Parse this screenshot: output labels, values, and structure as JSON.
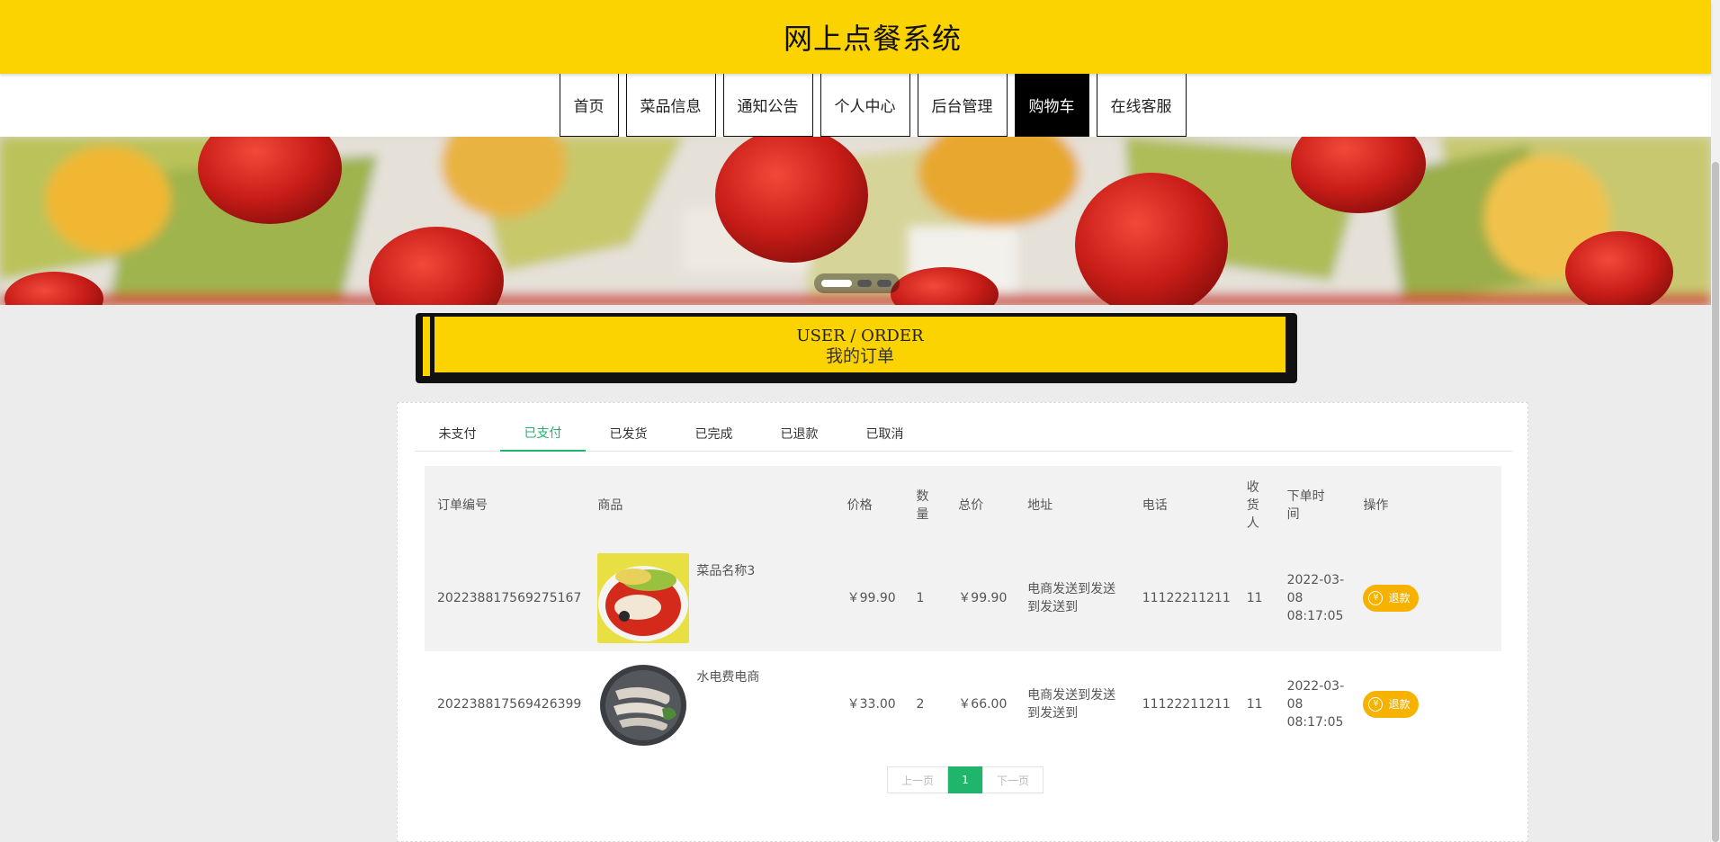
{
  "header": {
    "title": "网上点餐系统"
  },
  "nav": {
    "items": [
      {
        "label": "首页",
        "active": false
      },
      {
        "label": "菜品信息",
        "active": false
      },
      {
        "label": "通知公告",
        "active": false
      },
      {
        "label": "个人中心",
        "active": false
      },
      {
        "label": "后台管理",
        "active": false
      },
      {
        "label": "购物车",
        "active": true
      },
      {
        "label": "在线客服",
        "active": false
      }
    ]
  },
  "carousel": {
    "slides": 3,
    "active_index": 0
  },
  "section": {
    "title_en": "USER / ORDER",
    "title_cn": "我的订单"
  },
  "tabs": {
    "items": [
      "未支付",
      "已支付",
      "已发货",
      "已完成",
      "已退款",
      "已取消"
    ],
    "active_index": 1
  },
  "table": {
    "headers": {
      "order_no": "订单编号",
      "goods": "商品",
      "price": "价格",
      "qty": "数量",
      "total": "总价",
      "address": "地址",
      "phone": "电话",
      "receiver": "收货人",
      "time": "下单时间",
      "action": "操作"
    },
    "rows": [
      {
        "order_no": "202238817569275167",
        "goods_name": "菜品名称3",
        "goods_image": "fish-dish-image",
        "price": "￥99.90",
        "qty": "1",
        "total": "￥99.90",
        "address": "电商发送到发送到发送到",
        "phone": "11122211211",
        "receiver": "11",
        "time": "2022-03-08 08:17:05",
        "action": "退款"
      },
      {
        "order_no": "202238817569426399",
        "goods_name": "水电费电商",
        "goods_image": "shrimp-dish-image",
        "price": "￥33.00",
        "qty": "2",
        "total": "￥66.00",
        "address": "电商发送到发送到发送到",
        "phone": "11122211211",
        "receiver": "11",
        "time": "2022-03-08 08:17:05",
        "action": "退款"
      }
    ]
  },
  "pagination": {
    "prev": "上一页",
    "current": "1",
    "next": "下一页"
  },
  "colors": {
    "brand_yellow": "#fbd300",
    "accent_green": "#1fb56b",
    "button_orange": "#f7b200"
  }
}
